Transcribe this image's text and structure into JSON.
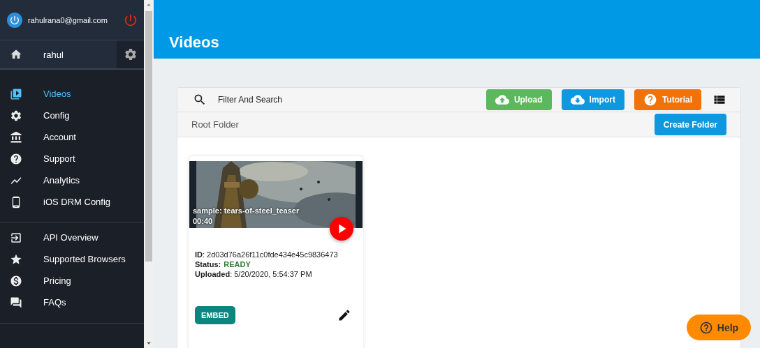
{
  "account": {
    "email": "rahulrana0@gmail.com"
  },
  "user": {
    "name": "rahul"
  },
  "nav_groups": [
    {
      "items": [
        {
          "label": "Videos",
          "selected": true
        },
        {
          "label": "Config",
          "selected": false
        },
        {
          "label": "Account",
          "selected": false
        },
        {
          "label": "Support",
          "selected": false
        },
        {
          "label": "Analytics",
          "selected": false
        },
        {
          "label": "iOS DRM Config",
          "selected": false
        }
      ]
    },
    {
      "items": [
        {
          "label": "API Overview",
          "selected": false
        },
        {
          "label": "Supported Browsers",
          "selected": false
        },
        {
          "label": "Pricing",
          "selected": false
        },
        {
          "label": "FAQs",
          "selected": false
        }
      ]
    }
  ],
  "page_title": "Videos",
  "toolbar": {
    "search_placeholder": "Filter And Search",
    "buttons": [
      {
        "label": "Upload",
        "kind": "upload"
      },
      {
        "label": "Import",
        "kind": "import"
      },
      {
        "label": "Tutorial",
        "kind": "tutorial"
      }
    ]
  },
  "folder": {
    "name": "Root Folder",
    "button": "Create Folder"
  },
  "videos": [
    {
      "title": "sample: tears-of-steel_teaser",
      "duration": "00:40",
      "id_line": "**ID**: 2d03d76a26f11c0fde434e45c9836473",
      "status_label": "Status:",
      "status": "READY",
      "uploaded_line": "**Uploaded**: 5/20/2020, 5:54:37 PM",
      "embed": "EMBED"
    }
  ],
  "help": "Help"
}
